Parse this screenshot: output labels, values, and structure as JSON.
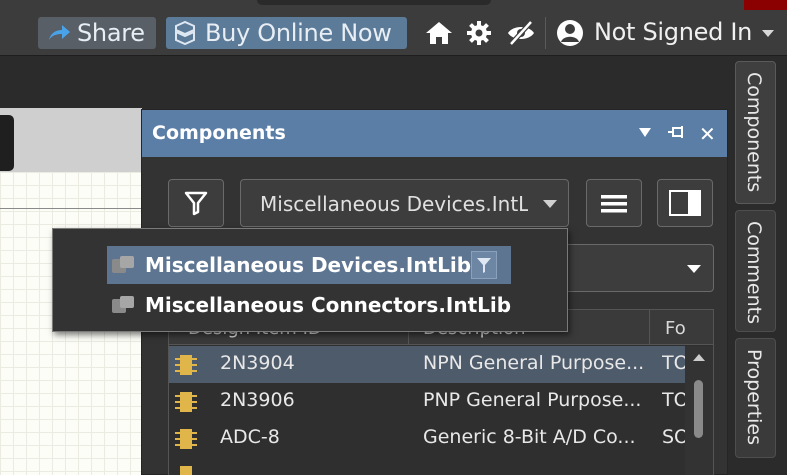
{
  "topbar": {
    "share_label": "Share",
    "buy_label": "Buy Online Now",
    "user_label": "Not Signed In",
    "icons": [
      "share-arrow-icon",
      "altium-logo-icon",
      "home-icon",
      "gear-icon",
      "eye-off-icon",
      "user-avatar-icon",
      "chevron-down-icon"
    ]
  },
  "panel": {
    "title": "Components",
    "library_select": {
      "value": "Miscellaneous Devices.IntLib"
    },
    "search": {
      "value": ""
    },
    "grid": {
      "columns": [
        "Design Item ID",
        "Description",
        "Fo"
      ],
      "rows": [
        {
          "id": "2N3904",
          "description": "NPN General Purpose...",
          "footprint": "TO",
          "selected": true
        },
        {
          "id": "2N3906",
          "description": "PNP General Purpose...",
          "footprint": "TO",
          "selected": false
        },
        {
          "id": "ADC-8",
          "description": "Generic 8-Bit A/D Co...",
          "footprint": "SO",
          "selected": false
        }
      ]
    }
  },
  "popup": {
    "items": [
      {
        "label": "Miscellaneous Devices.IntLib",
        "selected": true
      },
      {
        "label": "Miscellaneous Connectors.IntLib",
        "selected": false
      }
    ]
  },
  "side_tabs": [
    {
      "label": "Components"
    },
    {
      "label": "Comments"
    },
    {
      "label": "Properties"
    }
  ],
  "colors": {
    "panel_header": "#5b7ea6",
    "buy_button": "#5b7b99",
    "selection": "#5d7591"
  }
}
